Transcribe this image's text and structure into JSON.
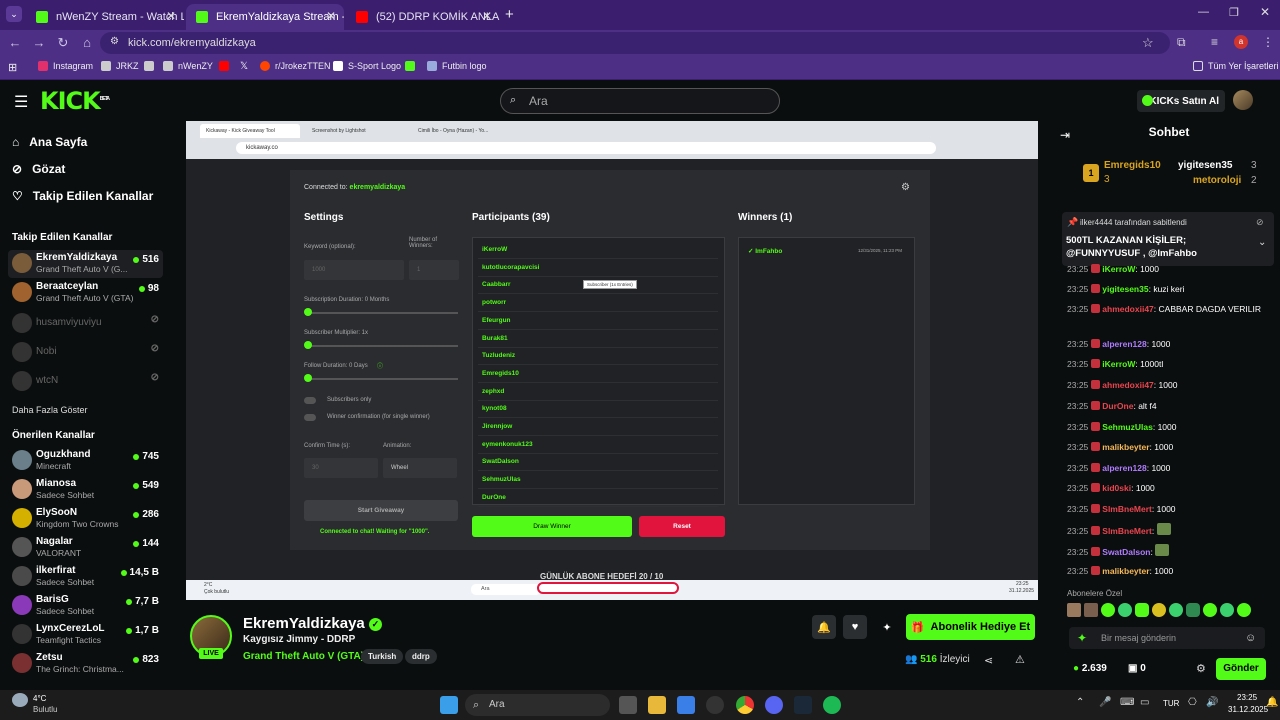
{
  "browser": {
    "tabs": [
      {
        "title": "nWenZY Stream - Watch Live on Kick",
        "active": false
      },
      {
        "title": "EkremYaldizkaya Stream - Watch Live on Kick",
        "active": true
      },
      {
        "title": "(52) DDRP KOMİK ANLAR 9. BÖLÜM",
        "active": false
      }
    ],
    "url": "kick.com/ekremyaldizkaya",
    "bookmarks": [
      "Instagram",
      "JRKZ",
      "nWenZY",
      "r/JrokezTTEN",
      "S-Sport Logo",
      "Futbin logo"
    ],
    "bookmarks_folder": "Tüm Yer İşaretleri",
    "profile_initial": "a"
  },
  "header": {
    "logo": "KICK",
    "logo_beta": "BETA",
    "search_placeholder": "Ara",
    "buy_kicks": "KICKs Satın Al"
  },
  "sidebar": {
    "nav": [
      "Ana Sayfa",
      "Gözat",
      "Takip Edilen Kanallar"
    ],
    "followed_title": "Takip Edilen Kanallar",
    "followed": [
      {
        "name": "EkremYaldizkaya",
        "game": "Grand Theft Auto V (G...",
        "viewers": "516",
        "live": true
      },
      {
        "name": "Beraatceylan",
        "game": "Grand Theft Auto V (GTA)",
        "viewers": "98",
        "live": true
      },
      {
        "name": "husamviyuviyu",
        "game": "",
        "viewers": "",
        "live": false
      },
      {
        "name": "Nobi",
        "game": "",
        "viewers": "",
        "live": false
      },
      {
        "name": "wtcN",
        "game": "",
        "viewers": "",
        "live": false
      }
    ],
    "show_more": "Daha Fazla Göster",
    "recommended_title": "Önerilen Kanallar",
    "recommended": [
      {
        "name": "Oguzkhand",
        "game": "Minecraft",
        "viewers": "745"
      },
      {
        "name": "Mianosa",
        "game": "Sadece Sohbet",
        "viewers": "549"
      },
      {
        "name": "ElySooN",
        "game": "Kingdom Two Crowns",
        "viewers": "286"
      },
      {
        "name": "Nagalar",
        "game": "VALORANT",
        "viewers": "144"
      },
      {
        "name": "ilkerfirat",
        "game": "Sadece Sohbet",
        "viewers": "14,5 B"
      },
      {
        "name": "BarisG",
        "game": "Sadece Sohbet",
        "viewers": "7,7 B"
      },
      {
        "name": "LynxCerezLoL",
        "game": "Teamfight Tactics",
        "viewers": "1,7 B"
      },
      {
        "name": "Zetsu",
        "game": "The Grinch: Christma...",
        "viewers": "823"
      }
    ]
  },
  "video": {
    "tabs": [
      "Kickaway - Kick Giveaway Tool",
      "Screenshot by Lightshot",
      "Cimili İbo - Oyna (Hazan) - Yo..."
    ],
    "url": "kickaway.co",
    "connected_label": "Connected to:",
    "connected_user": "ekremyaldizkaya",
    "settings_title": "Settings",
    "keyword_label": "Keyword (optional):",
    "winners_label": "Number of Winners:",
    "keyword_value": "1000",
    "winners_value": "1",
    "sub_duration": "Subscription Duration: 0 Months",
    "sub_multiplier": "Subscriber Multiplier: 1x",
    "follow_duration": "Follow Duration: 0 Days",
    "subscribers_only": "Subscribers only",
    "winner_confirm": "Winner confirmation (for single winner)",
    "confirm_time": "Confirm Time (s):",
    "confirm_value": "30",
    "animation_label": "Animation:",
    "animation_value": "Wheel",
    "start_btn": "Start Giveaway",
    "status": "Connected to chat! Waiting for \"1000\".",
    "participants_title": "Participants (39)",
    "participants": [
      "iKerroW",
      "kutotlucorapavcisi",
      "Caabbarr",
      "potworr",
      "Efeurgun",
      "Burak81",
      "Tuzludeniz",
      "Emregids10",
      "zephxd",
      "kynot08",
      "Jirennjow",
      "eymenkonuk123",
      "SwatDalson",
      "SehmuzUlas",
      "DurOne"
    ],
    "tooltip": "Subscriber (1x Entries)",
    "winners_title": "Winners (1)",
    "winner": "✓ ImFahbo",
    "winner_time": "12/31/2025, 11:23 PM",
    "draw_btn": "Draw Winner",
    "reset_btn": "Reset",
    "overlay_goal": "GÜNLÜK ABONE HEDEFİ   20 / 10",
    "taskbar_search": "Ara",
    "weather": "2°C",
    "weather_desc": "Çok bulutlu",
    "clock": "23:25",
    "date": "31.12.2025"
  },
  "stream": {
    "name": "EkremYaldizkaya",
    "title": "Kaygısız Jimmy - DDRP",
    "game": "Grand Theft Auto V (GTA)",
    "tags": [
      "Turkish",
      "ddrp"
    ],
    "live": "LIVE",
    "viewers": "516",
    "viewers_label": "İzleyici",
    "gift_btn": "Abonelik Hediye Et"
  },
  "chat": {
    "title": "Sohbet",
    "leaders": [
      {
        "name": "Emregids10",
        "count": "3"
      },
      {
        "name": "yigitesen35",
        "count": "3"
      },
      {
        "name": "metoroloji",
        "count": "2"
      }
    ],
    "pinned_by": "ilker4444 tarafından sabitlendi",
    "pinned_text": "500TL KAZANAN KİŞİLER; @FUNNYYUSUF , @ImFahbo",
    "messages": [
      {
        "time": "23:25",
        "user": "iKerroW",
        "text": "1000",
        "color": "#53fc18"
      },
      {
        "time": "23:25",
        "user": "yigitesen35",
        "text": "kuzi keri",
        "color": "#53fc18"
      },
      {
        "time": "23:25",
        "user": "ahmedoxii47",
        "text": "CABBAR DAGDA VERILIR",
        "color": "#e9454f"
      },
      {
        "time": "23:25",
        "user": "alperen128",
        "text": "1000",
        "color": "#b07cff"
      },
      {
        "time": "23:25",
        "user": "iKerroW",
        "text": "1000tl",
        "color": "#53fc18"
      },
      {
        "time": "23:25",
        "user": "ahmedoxii47",
        "text": "1000",
        "color": "#e9454f"
      },
      {
        "time": "23:25",
        "user": "DurOne",
        "text": "alt f4",
        "color": "#e9454f"
      },
      {
        "time": "23:25",
        "user": "SehmuzUlas",
        "text": "1000",
        "color": "#53fc18"
      },
      {
        "time": "23:25",
        "user": "malikbeyter",
        "text": "1000",
        "color": "#f5b85a"
      },
      {
        "time": "23:25",
        "user": "alperen128",
        "text": "1000",
        "color": "#b07cff"
      },
      {
        "time": "23:25",
        "user": "kid0ski",
        "text": "1000",
        "color": "#e9454f"
      },
      {
        "time": "23:25",
        "user": "SlmBneMert",
        "text": "1000",
        "color": "#e9454f"
      },
      {
        "time": "23:25",
        "user": "SlmBneMert",
        "text": "",
        "color": "#e9454f"
      },
      {
        "time": "23:25",
        "user": "SwatDalson",
        "text": "",
        "color": "#b07cff"
      },
      {
        "time": "23:25",
        "user": "malikbeyter",
        "text": "1000",
        "color": "#f5b85a"
      }
    ],
    "sub_emotes_label": "Abonelere Özel",
    "input_placeholder": "Bir mesaj gönderin",
    "points": "2.639",
    "gifts": "0",
    "send_btn": "Gönder"
  },
  "taskbar": {
    "weather_temp": "4°C",
    "weather_desc": "Bulutlu",
    "search": "Ara",
    "lang": "TUR",
    "time": "23:25",
    "date": "31.12.2025"
  }
}
